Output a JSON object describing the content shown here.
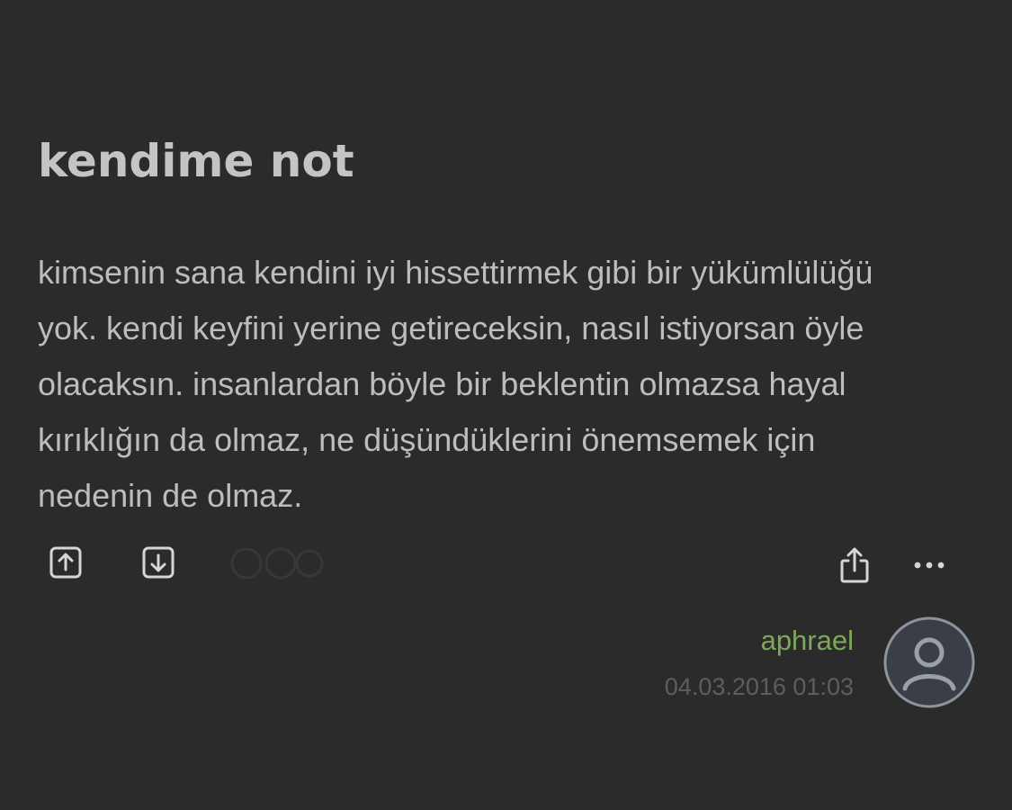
{
  "entry": {
    "title": "kendime not",
    "body_lines": [
      "kimsenin sana kendini iyi hissettirmek gibi bir yükümlülüğü",
      "yok. kendi keyfini yerine getireceksin, nasıl istiyorsan öyle",
      "olacaksın. insanlardan böyle bir beklentin olmazsa hayal",
      "kırıklığın da olmaz, ne düşündüklerini önemsemek için",
      "nedenin de olmaz."
    ],
    "author": "aphrael",
    "timestamp": "04.03.2016 01:03"
  },
  "icons": {
    "upvote": "arrow-up-box-icon",
    "downvote": "arrow-down-box-icon",
    "share": "share-icon",
    "more": "more-dots-icon",
    "avatar": "user-avatar-icon"
  },
  "colors": {
    "background": "#2b2b2b",
    "title": "#c4c4c4",
    "body": "#bdbdbd",
    "author": "#7da85a",
    "timestamp": "#5e5e5e",
    "icon": "#d6d6d6",
    "avatar_bg": "#3a3f47",
    "avatar_ring": "#9aa0a8"
  }
}
